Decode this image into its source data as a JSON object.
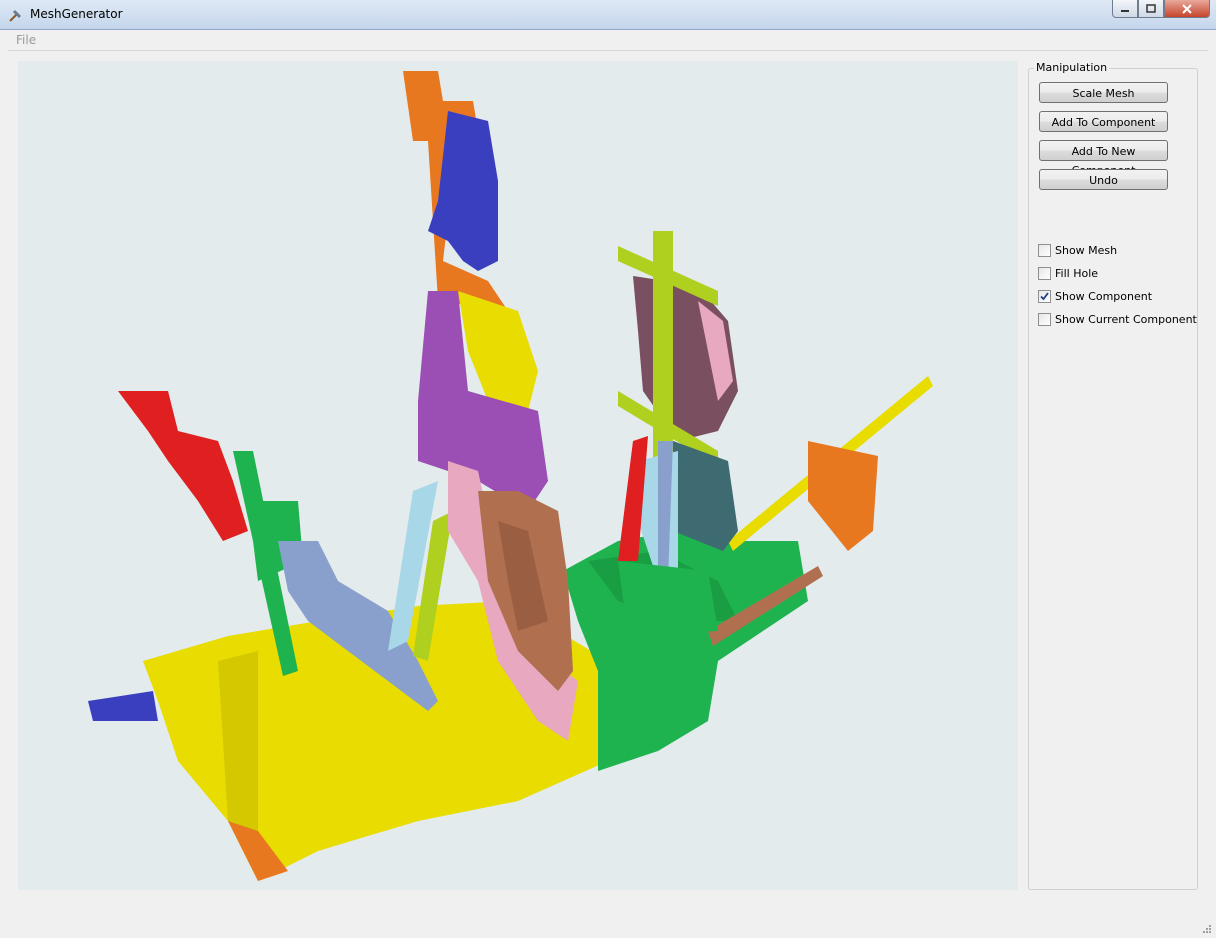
{
  "window": {
    "title": "MeshGenerator"
  },
  "menu": {
    "file": "File"
  },
  "panel": {
    "title": "Manipulation",
    "buttons": [
      "Scale Mesh",
      "Add To Component",
      "Add To New Component",
      "Undo"
    ],
    "checkboxes": [
      {
        "label": "Show Mesh",
        "checked": false
      },
      {
        "label": "Fill Hole",
        "checked": false
      },
      {
        "label": "Show Component",
        "checked": true
      },
      {
        "label": "Show Current Component",
        "checked": false
      }
    ]
  },
  "viewport": {
    "background": "#e3ebed"
  },
  "component_colors": [
    "#e8dc00",
    "#1fb34f",
    "#e87820",
    "#3a3fbf",
    "#9b4fb5",
    "#e8a8c0",
    "#b07050",
    "#b0d020",
    "#e02020",
    "#8aa0cc",
    "#a8d8e8",
    "#7a5060",
    "#3e6a72"
  ]
}
